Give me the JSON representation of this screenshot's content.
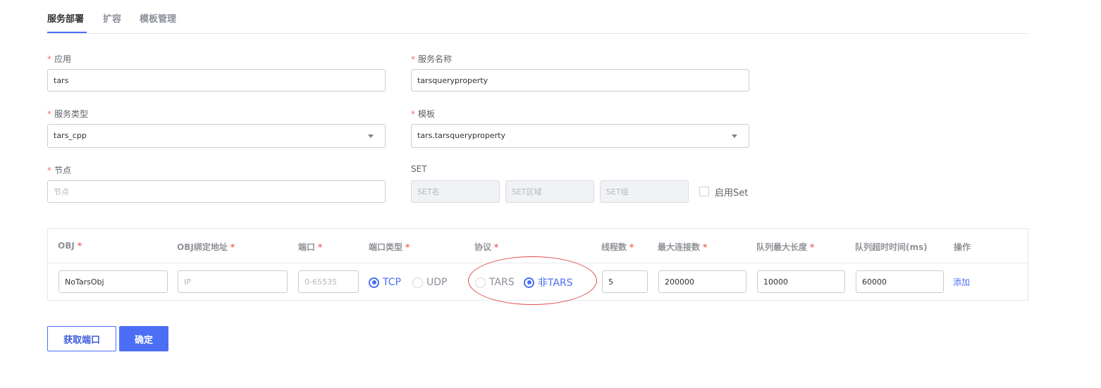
{
  "tabs": [
    {
      "label": "服务部署",
      "active": true
    },
    {
      "label": "扩容",
      "active": false
    },
    {
      "label": "模板管理",
      "active": false
    }
  ],
  "form": {
    "app": {
      "label": "应用",
      "required": true,
      "value": "tars"
    },
    "server_name": {
      "label": "服务名称",
      "required": true,
      "value": "tarsqueryproperty"
    },
    "server_type": {
      "label": "服务类型",
      "required": true,
      "value": "tars_cpp"
    },
    "template": {
      "label": "模板",
      "required": true,
      "value": "tars.tarsqueryproperty"
    },
    "node": {
      "label": "节点",
      "required": true,
      "value": "",
      "placeholder": "节点"
    },
    "set": {
      "label": "SET",
      "name_placeholder": "SET名",
      "area_placeholder": "SET区域",
      "group_placeholder": "SET组",
      "enable_label": "启用Set",
      "enabled": false
    }
  },
  "required_mark": "*",
  "table": {
    "headers": {
      "obj": "OBJ",
      "bind": "OBJ绑定地址",
      "port": "端口",
      "port_type": "端口类型",
      "protocol": "协议",
      "threads": "线程数",
      "max_conn": "最大连接数",
      "queue_len": "队列最大长度",
      "queue_timeout": "队列超时时间(ms)",
      "operation": "操作"
    },
    "row": {
      "obj": "NoTarsObj",
      "bind_placeholder": "IP",
      "bind": "",
      "port_placeholder": "0-65535",
      "port": "",
      "port_type_options": [
        "TCP",
        "UDP"
      ],
      "port_type_selected": "TCP",
      "protocol_options": [
        "TARS",
        "非TARS"
      ],
      "protocol_selected": "非TARS",
      "threads": "5",
      "max_conn": "200000",
      "queue_len": "10000",
      "queue_timeout": "60000",
      "add_label": "添加"
    }
  },
  "buttons": {
    "get_port": "获取端口",
    "confirm": "确定"
  },
  "colors": {
    "primary": "#4c6ef5",
    "required": "#f56c6c",
    "annotation": "#e04a4a"
  }
}
